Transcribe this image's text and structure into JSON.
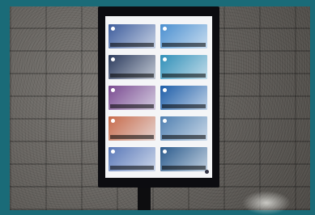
{
  "scene": {
    "description_tag": "photo",
    "colors": {
      "frame": "#1a6b78",
      "wall": "#6a6762",
      "monitor": "#0c0c10",
      "screen": "#f4f5f7"
    },
    "tiles": [
      {
        "color": "#3d5c9c"
      },
      {
        "color": "#4a8fd0"
      },
      {
        "color": "#2b3a5c"
      },
      {
        "color": "#2f8fb8"
      },
      {
        "color": "#7a4a90"
      },
      {
        "color": "#1d5da8"
      },
      {
        "color": "#c76a4a"
      },
      {
        "color": "#4f7fb0"
      },
      {
        "color": "#5a78b8"
      },
      {
        "color": "#2a5a8c"
      }
    ]
  }
}
